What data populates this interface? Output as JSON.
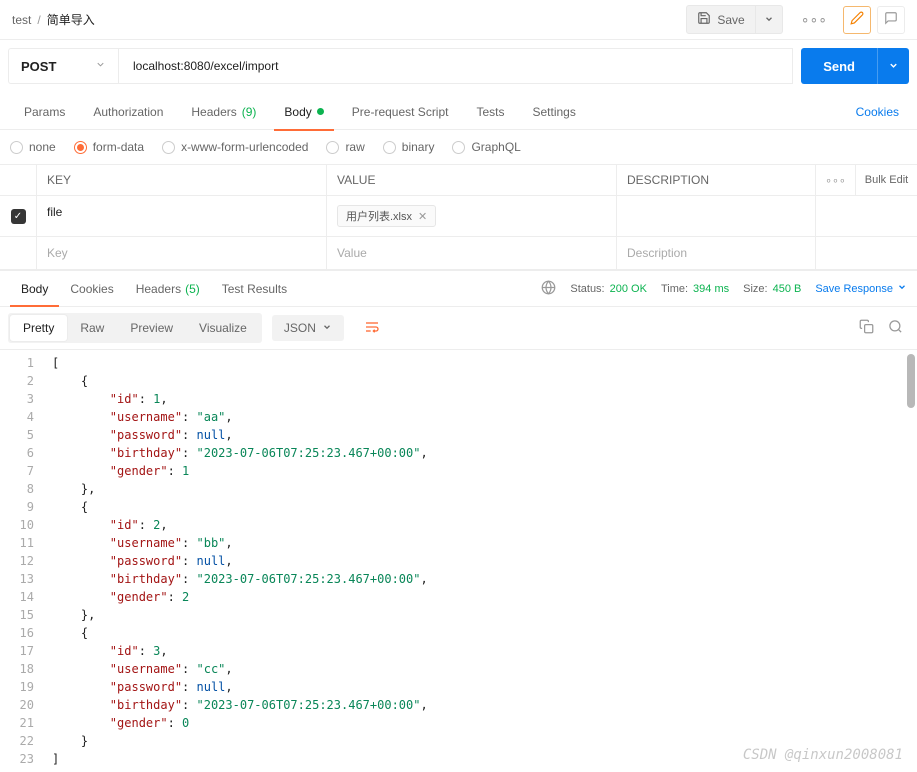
{
  "breadcrumb": {
    "root": "test",
    "name": "简单导入"
  },
  "topbar": {
    "save": "Save"
  },
  "request": {
    "method": "POST",
    "url": "localhost:8080/excel/import",
    "send": "Send"
  },
  "tabs": {
    "params": "Params",
    "authorization": "Authorization",
    "headers": "Headers",
    "headers_count": "(9)",
    "body": "Body",
    "prerequest": "Pre-request Script",
    "tests": "Tests",
    "settings": "Settings",
    "cookies_link": "Cookies"
  },
  "body_types": {
    "none": "none",
    "form_data": "form-data",
    "urlencoded": "x-www-form-urlencoded",
    "raw": "raw",
    "binary": "binary",
    "graphql": "GraphQL"
  },
  "params_table": {
    "key_header": "KEY",
    "value_header": "VALUE",
    "desc_header": "DESCRIPTION",
    "bulk": "Bulk Edit",
    "key_placeholder": "Key",
    "value_placeholder": "Value",
    "desc_placeholder": "Description",
    "row1_key": "file",
    "row1_file": "用户列表.xlsx"
  },
  "response_tabs": {
    "body": "Body",
    "cookies": "Cookies",
    "headers": "Headers",
    "headers_count": "(5)",
    "test_results": "Test Results"
  },
  "response_meta": {
    "status_label": "Status:",
    "status_value": "200 OK",
    "time_label": "Time:",
    "time_value": "394 ms",
    "size_label": "Size:",
    "size_value": "450 B",
    "save_response": "Save Response"
  },
  "viewer": {
    "pretty": "Pretty",
    "raw": "Raw",
    "preview": "Preview",
    "visualize": "Visualize",
    "format": "JSON"
  },
  "json_response": [
    {
      "id": 1,
      "username": "aa",
      "password": null,
      "birthday": "2023-07-06T07:25:23.467+00:00",
      "gender": 1
    },
    {
      "id": 2,
      "username": "bb",
      "password": null,
      "birthday": "2023-07-06T07:25:23.467+00:00",
      "gender": 2
    },
    {
      "id": 3,
      "username": "cc",
      "password": null,
      "birthday": "2023-07-06T07:25:23.467+00:00",
      "gender": 0
    }
  ],
  "watermark": "CSDN @qinxun2008081"
}
